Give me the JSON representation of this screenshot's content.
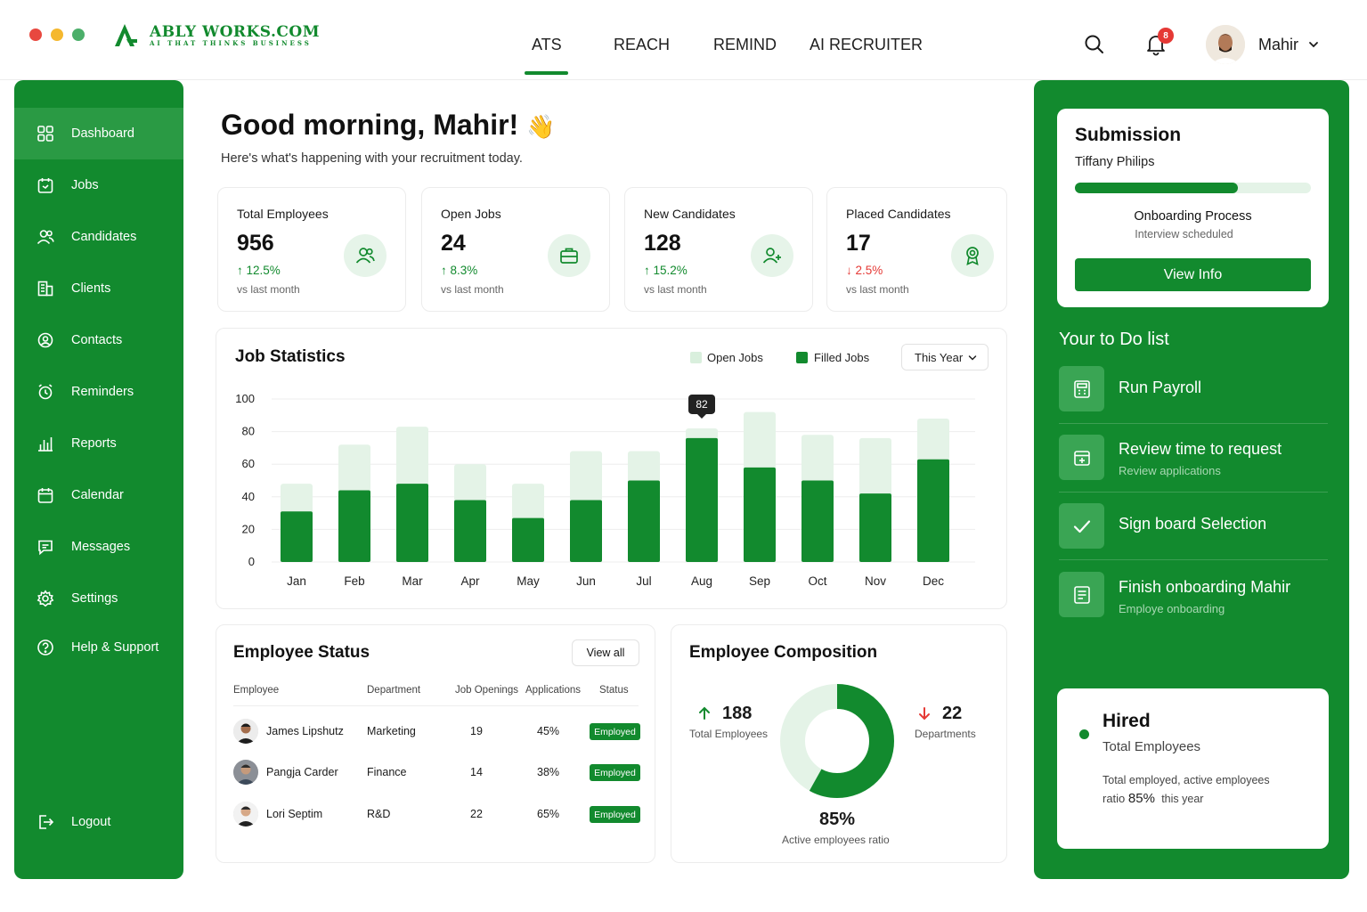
{
  "brand": {
    "name": "ABLY WORKS.COM",
    "tagline": "AI THAT THINKS BUSINESS",
    "color": "#128a2e"
  },
  "nav": {
    "tabs": [
      "ATS",
      "REACH",
      "REMIND",
      "AI RECRUITER"
    ],
    "active": "ATS"
  },
  "header": {
    "notifications": "8",
    "user_name": "Mahir"
  },
  "sidebar": {
    "items": [
      {
        "label": "Dashboard",
        "icon": "grid-icon"
      },
      {
        "label": "Jobs",
        "icon": "briefcase-calendar-icon"
      },
      {
        "label": "Candidates",
        "icon": "users-icon"
      },
      {
        "label": "Clients",
        "icon": "building-icon"
      },
      {
        "label": "Contacts",
        "icon": "contact-icon"
      },
      {
        "label": "Reminders",
        "icon": "alarm-icon"
      },
      {
        "label": "Reports",
        "icon": "bar-chart-icon"
      },
      {
        "label": "Calendar",
        "icon": "calendar-icon"
      },
      {
        "label": "Messages",
        "icon": "message-icon"
      },
      {
        "label": "Settings",
        "icon": "gear-icon"
      },
      {
        "label": "Help & Support",
        "icon": "help-icon"
      }
    ],
    "logout": "Logout"
  },
  "greeting": {
    "title": "Good morning, Mahir!",
    "emoji": "👋",
    "subtitle": "Here's what's happening with your recruitment today."
  },
  "stats": [
    {
      "title": "Total Employees",
      "value": "956",
      "delta": "↑ 12.5%",
      "trend": "up",
      "sub": "vs last month",
      "icon": "users-icon"
    },
    {
      "title": "Open Jobs",
      "value": "24",
      "delta": "↑ 8.3%",
      "trend": "up",
      "sub": "vs last month",
      "icon": "briefcase-icon"
    },
    {
      "title": "New Candidates",
      "value": "128",
      "delta": "↑ 15.2%",
      "trend": "up",
      "sub": "vs last month",
      "icon": "user-plus-icon"
    },
    {
      "title": "Placed Candidates",
      "value": "17",
      "delta": "↓ 2.5%",
      "trend": "down",
      "sub": "vs last month",
      "icon": "award-icon"
    }
  ],
  "job_stats": {
    "title": "Job Statistics",
    "legend": [
      "Open Jobs",
      "Filled Jobs"
    ],
    "period": "This Year",
    "tooltip": "82"
  },
  "chart_data": {
    "type": "bar",
    "categories": [
      "Jan",
      "Feb",
      "Mar",
      "Apr",
      "May",
      "Jun",
      "Jul",
      "Aug",
      "Sep",
      "Oct",
      "Nov",
      "Dec"
    ],
    "series": [
      {
        "name": "Open Jobs",
        "values": [
          48,
          72,
          83,
          60,
          48,
          68,
          68,
          82,
          92,
          78,
          76,
          88
        ]
      },
      {
        "name": "Filled Jobs",
        "values": [
          31,
          44,
          48,
          38,
          27,
          38,
          50,
          76,
          58,
          50,
          42,
          63
        ]
      }
    ],
    "y_ticks": [
      0,
      20,
      40,
      60,
      80,
      100
    ],
    "ylim": [
      0,
      100
    ],
    "colors": {
      "Open Jobs": "#e4f3e7",
      "Filled Jobs": "#128a2e"
    },
    "highlight": {
      "category": "Aug",
      "label": "82"
    },
    "grid": true,
    "legend_position": "top-right"
  },
  "employee_status": {
    "title": "Employee Status",
    "view_all": "View all",
    "columns": [
      "Employee",
      "Department",
      "Job Openings",
      "Applications",
      "Status"
    ],
    "rows": [
      {
        "name": "James Lipshutz",
        "department": "Marketing",
        "openings": "19",
        "applications": "45%",
        "status": "Employed"
      },
      {
        "name": "Pangja Carder",
        "department": "Finance",
        "openings": "14",
        "applications": "38%",
        "status": "Employed"
      },
      {
        "name": "Lori Septim",
        "department": "R&D",
        "openings": "22",
        "applications": "65%",
        "status": "Employed"
      }
    ]
  },
  "composition": {
    "title": "Employee Composition",
    "left_value": "188",
    "left_label": "Total Employees",
    "right_value": "22",
    "right_label": "Departments",
    "ratio_value": "85%",
    "ratio_label": "Active employees ratio",
    "active_fraction": 0.58
  },
  "submission": {
    "title": "Submission",
    "name": "Tiffany Philips",
    "progress": 0.69,
    "process": "Onboarding Process",
    "process_sub": "Interview scheduled",
    "button": "View Info"
  },
  "todo": {
    "title": "Your to Do list",
    "items": [
      {
        "title": "Run Payroll",
        "sub": "",
        "icon": "calculator-icon"
      },
      {
        "title": "Review time to request",
        "sub": "Review applications",
        "icon": "calendar-add-icon"
      },
      {
        "title": "Sign board Selection",
        "sub": "",
        "icon": "check-icon"
      },
      {
        "title": "Finish onboarding Mahir",
        "sub": "Employe onboarding",
        "icon": "document-icon"
      }
    ]
  },
  "hired": {
    "title": "Hired",
    "subtitle": "Total Employees",
    "desc": "Total employed, active employees",
    "ratio_prefix": "ratio",
    "ratio_value": "85%",
    "ratio_suffix": "this year"
  }
}
